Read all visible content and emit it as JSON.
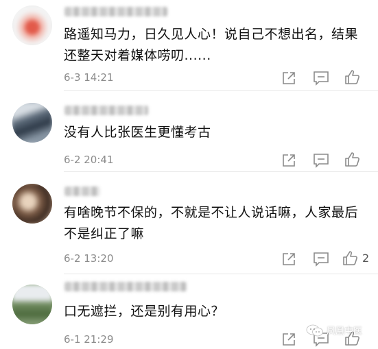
{
  "comments": [
    {
      "text": "路遥知马力，日久见人心！说自己不想出名，结果还整天对着媒体唠叨......",
      "time": "6-3 14:21",
      "likes": ""
    },
    {
      "text": "没有人比张医生更懂考古",
      "time": "6-2 20:41",
      "likes": ""
    },
    {
      "text": "有啥晚节不保的，不就是不让人说话嘛，人家最后不是纠正了嘛",
      "time": "6-2 13:20",
      "likes": "2"
    },
    {
      "text": "口无遮拦，还是别有用心？",
      "time": "6-1 21:29",
      "likes": ""
    }
  ],
  "icons": {
    "share": "share-icon",
    "reply": "comment-icon",
    "like": "thumbs-up-icon"
  },
  "watermark": {
    "label": "凤凰中医"
  },
  "colors": {
    "text": "#111111",
    "meta": "#8c8c8c",
    "icon": "#8a8a8a",
    "divider": "#e6e6e6"
  }
}
